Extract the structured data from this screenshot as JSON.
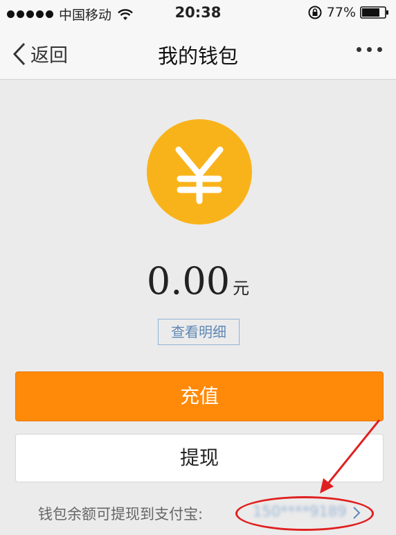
{
  "status_bar": {
    "carrier": "中国移动",
    "time": "20:38",
    "battery": "77%"
  },
  "nav": {
    "back_label": "返回",
    "title": "我的钱包"
  },
  "wallet": {
    "balance": "0.00",
    "unit": "元",
    "detail_label": "查看明细",
    "recharge_label": "充值",
    "withdraw_label": "提现",
    "footer_text": "钱包余额可提现到支付宝:",
    "account": "150****9189"
  },
  "colors": {
    "accent_orange": "#ff8a09",
    "yuan_icon": "#f9b31a",
    "link_blue": "#5e88b6",
    "annotation_red": "#e02020"
  },
  "icons": [
    "wifi-icon",
    "rotation-lock-icon",
    "battery-icon",
    "back-chevron-icon",
    "more-icon",
    "yuan-icon",
    "chevron-right-icon"
  ]
}
